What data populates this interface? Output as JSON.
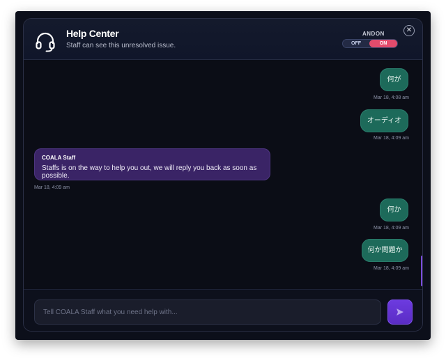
{
  "header": {
    "title": "Help Center",
    "subtitle": "Staff can see this unresolved issue.",
    "andon_label": "ANDON",
    "toggle_off": "OFF",
    "toggle_on": "ON",
    "close_icon": "close-icon"
  },
  "messages": [
    {
      "from": "me",
      "text": "何が",
      "time": "Mar 18, 4:08 am"
    },
    {
      "from": "me",
      "text": "オーディオ",
      "time": "Mar 18, 4:09 am"
    },
    {
      "from": "staff",
      "sender": "COALA Staff",
      "text": "Staffs is on the way to help you out, we will reply you back as soon as possible.",
      "time": "Mar 18, 4:09 am"
    },
    {
      "from": "me",
      "text": "何か",
      "time": "Mar 18, 4:09 am"
    },
    {
      "from": "me",
      "text": "何か問題か",
      "time": "Mar 18, 4:09 am"
    }
  ],
  "composer": {
    "placeholder": "Tell COALA Staff what you need help with...",
    "send_icon": "send-icon"
  },
  "colors": {
    "accent": "#6d3be0",
    "toggle_on": "#e34c6c",
    "my_bubble": "#1d6a5a",
    "staff_bubble": "#3a2466"
  }
}
